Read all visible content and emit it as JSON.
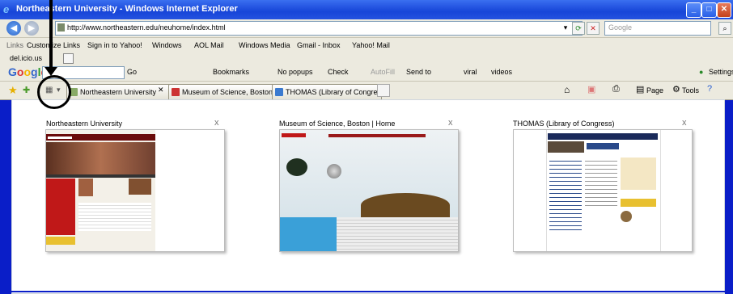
{
  "window": {
    "title": "Northeastern University - Windows Internet Explorer"
  },
  "address": {
    "url": "http://www.northeastern.edu/neuhome/index.html",
    "search_placeholder": "Google"
  },
  "links_bar": {
    "label": "Links",
    "items": [
      "Customize Links",
      "Sign in to Yahoo!",
      "Windows",
      "AOL Mail",
      "Windows Media",
      "Gmail - Inbox",
      "Yahoo! Mail"
    ],
    "row2": [
      "del.icio.us"
    ]
  },
  "google_bar": {
    "logo": "Google",
    "go": "Go",
    "bookmarks": "Bookmarks",
    "popups": "No popups",
    "check": "Check",
    "autofill": "AutoFill",
    "sendto": "Send to",
    "viral": "viral",
    "videos": "videos",
    "settings": "Settings"
  },
  "tabs": [
    {
      "label": "Northeastern University"
    },
    {
      "label": "Museum of Science, Boston |..."
    },
    {
      "label": "THOMAS (Library of Congress)"
    }
  ],
  "toolbar": {
    "page": "Page",
    "tools": "Tools"
  },
  "quick_tabs": [
    {
      "title": "Northeastern University",
      "close": "x"
    },
    {
      "title": "Museum of Science, Boston | Home",
      "close": "x"
    },
    {
      "title": "THOMAS (Library of Congress)",
      "close": "x"
    }
  ],
  "colors": {
    "title_bar": "#1745d8",
    "chrome": "#eceadf",
    "frame": "#0a1ec8"
  }
}
